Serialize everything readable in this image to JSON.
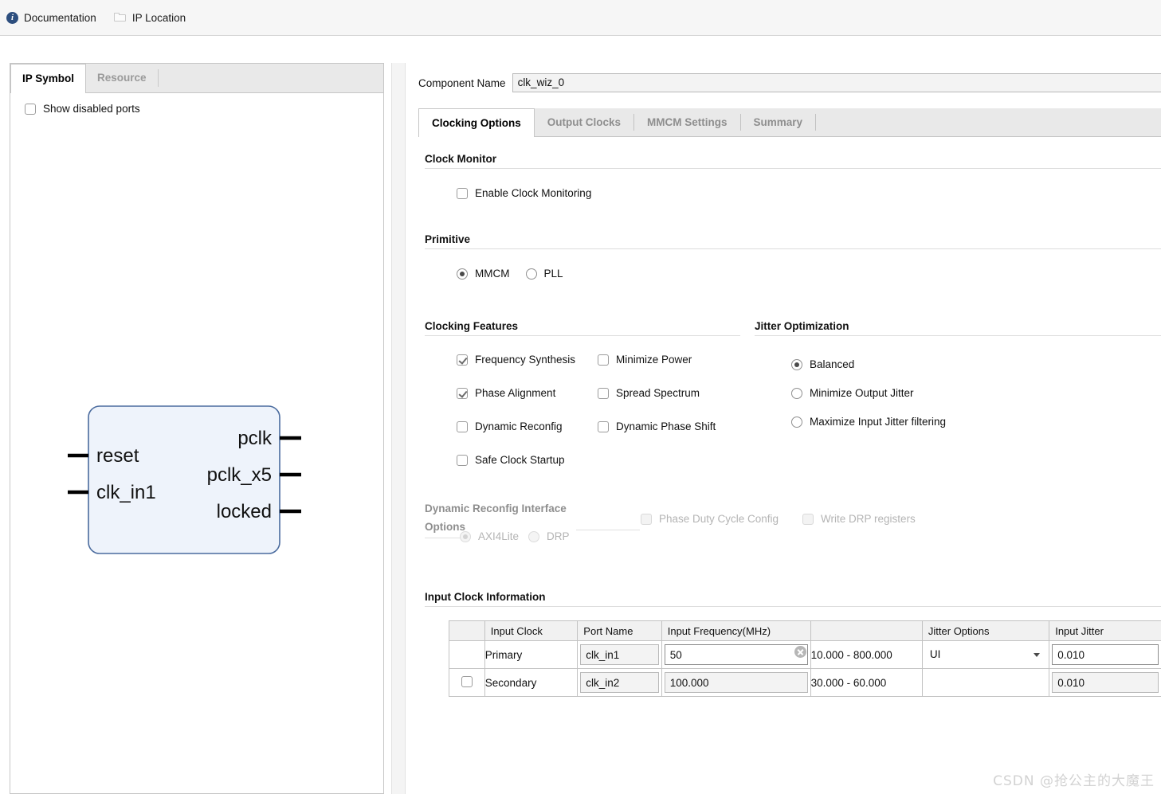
{
  "toolbar": {
    "documentation": "Documentation",
    "ip_location": "IP Location"
  },
  "left_panel": {
    "tabs": [
      {
        "label": "IP Symbol",
        "active": true
      },
      {
        "label": "Resource",
        "active": false
      }
    ],
    "show_disabled_ports": "Show disabled ports",
    "symbol": {
      "inputs": [
        "reset",
        "clk_in1"
      ],
      "outputs": [
        "pclk",
        "pclk_x5",
        "locked"
      ],
      "fill": "#eef3fb",
      "stroke": "#4a6b9e"
    }
  },
  "component": {
    "label": "Component Name",
    "value": "clk_wiz_0"
  },
  "tabs": [
    {
      "label": "Clocking Options",
      "active": true
    },
    {
      "label": "Output Clocks",
      "active": false
    },
    {
      "label": "MMCM Settings",
      "active": false
    },
    {
      "label": "Summary",
      "active": false
    }
  ],
  "clock_monitor": {
    "title": "Clock Monitor",
    "enable_label": "Enable Clock Monitoring",
    "enable_checked": false
  },
  "primitive": {
    "title": "Primitive",
    "options": [
      {
        "label": "MMCM",
        "selected": true
      },
      {
        "label": "PLL",
        "selected": false
      }
    ]
  },
  "clocking_features": {
    "title": "Clocking Features",
    "col1": [
      {
        "label": "Frequency Synthesis",
        "checked": true
      },
      {
        "label": "Phase Alignment",
        "checked": true
      },
      {
        "label": "Dynamic Reconfig",
        "checked": false
      },
      {
        "label": "Safe Clock Startup",
        "checked": false
      }
    ],
    "col2": [
      {
        "label": "Minimize Power",
        "checked": false
      },
      {
        "label": "Spread Spectrum",
        "checked": false
      },
      {
        "label": "Dynamic Phase Shift",
        "checked": false
      }
    ]
  },
  "jitter_optimization": {
    "title": "Jitter Optimization",
    "options": [
      {
        "label": "Balanced",
        "selected": true
      },
      {
        "label": "Minimize Output Jitter",
        "selected": false
      },
      {
        "label": "Maximize Input Jitter filtering",
        "selected": false
      }
    ]
  },
  "dynamic_reconfig": {
    "title_line1": "Dynamic Reconfig Interface",
    "title_line2": "Options",
    "radios": [
      {
        "label": "AXI4Lite",
        "selected": true
      },
      {
        "label": "DRP",
        "selected": false
      }
    ],
    "checks": [
      {
        "label": "Phase Duty Cycle Config",
        "checked": false
      },
      {
        "label": "Write DRP registers",
        "checked": false
      }
    ],
    "disabled": true
  },
  "input_clock_information": {
    "title": "Input Clock Information",
    "columns": [
      "",
      "Input Clock",
      "Port Name",
      "Input Frequency(MHz)",
      "",
      "Jitter Options",
      "Input Jitter"
    ],
    "rows": [
      {
        "enabled_checkbox": null,
        "input_clock": "Primary",
        "port_name": "clk_in1",
        "input_frequency": "50",
        "frequency_range": "10.000 - 800.000",
        "jitter_options": "UI",
        "input_jitter": "0.010",
        "active": true
      },
      {
        "enabled_checkbox": false,
        "input_clock": "Secondary",
        "port_name": "clk_in2",
        "input_frequency": "100.000",
        "frequency_range": "30.000 - 60.000",
        "jitter_options": "",
        "input_jitter": "0.010",
        "active": false
      }
    ]
  },
  "watermark": "CSDN @抢公主的大魔王"
}
